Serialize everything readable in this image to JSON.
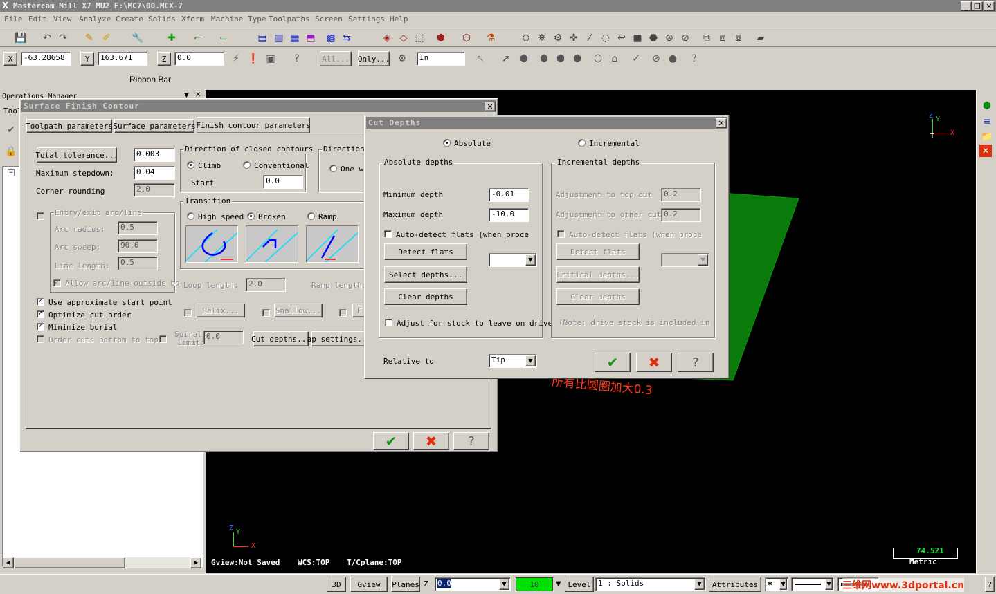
{
  "app": {
    "title": "Mastercam Mill X7 MU2  F:\\MC7\\00.MCX-7",
    "menu": [
      "File",
      "Edit",
      "View",
      "Analyze",
      "Create",
      "Solids",
      "Xform",
      "Machine Type",
      "Toolpaths",
      "Screen",
      "Settings",
      "Help"
    ]
  },
  "coords": {
    "x_label": "X",
    "x_value": "-63.28658",
    "y_label": "Y",
    "y_value": "163.671",
    "z_label": "Z",
    "z_value": "0.0",
    "all_label": "All...",
    "only_label": "Only...",
    "units": "In"
  },
  "ribbon_bar_label": "Ribbon Bar",
  "ops_manager": {
    "title": "Operations Manager",
    "tab_label": "Tool"
  },
  "surface_dialog": {
    "title": "Surface Finish Contour",
    "tabs": [
      "Toolpath parameters",
      "Surface parameters",
      "Finish contour parameters"
    ],
    "total_tolerance_btn": "Total tolerance...",
    "total_tolerance": "0.003",
    "max_stepdown_label": "Maximum stepdown:",
    "max_stepdown": "0.04",
    "corner_rounding_label": "Corner rounding",
    "corner_rounding": "2.0",
    "entry_exit_label": "Entry/exit arc/line",
    "arc_radius_label": "Arc radius:",
    "arc_radius": "0.5",
    "arc_sweep_label": "Arc sweep:",
    "arc_sweep": "90.0",
    "line_length_label": "Line length:",
    "line_length": "0.5",
    "allow_outside_label": "Allow arc/line outside bo",
    "use_approx_label": "Use approximate start point",
    "optimize_label": "Optimize cut order",
    "minimize_label": "Minimize burial",
    "order_cuts_label": "Order cuts bottom to top",
    "direction_closed_title": "Direction of closed contours",
    "climb_label": "Climb",
    "conventional_label": "Conventional",
    "start_label": "Start",
    "start_value": "0.0",
    "direction_open_title": "Direction",
    "one_way_label": "One wa",
    "transition_title": "Transition",
    "high_speed_label": "High speed",
    "broken_label": "Broken",
    "ramp_label": "Ramp",
    "loop_length_label": "Loop length:",
    "loop_length": "2.0",
    "ramp_length_label": "Ramp length:",
    "helix_btn": "Helix...",
    "shallow_btn": "Shallow...",
    "f_btn": "F",
    "spiral_label_1": "Spiral",
    "spiral_label_2": "limit:",
    "spiral_value": "0.0",
    "cut_depths_btn": "Cut depths...",
    "gap_settings_btn": "ap settings..."
  },
  "cut_depths_dialog": {
    "title": "Cut Depths",
    "absolute_label": "Absolute",
    "incremental_label": "Incremental",
    "abs_group_title": "Absolute depths",
    "min_depth_label": "Minimum depth",
    "min_depth": "-0.01",
    "max_depth_label": "Maximum depth",
    "max_depth": "-10.0",
    "auto_detect_label": "Auto-detect flats (when proce",
    "detect_flats_btn": "Detect flats",
    "select_depths_btn": "Select depths...",
    "clear_depths_btn": "Clear depths",
    "adjust_stock_label": "Adjust for stock to leave on drive",
    "inc_group_title": "Incremental depths",
    "adj_top_label": "Adjustment to top cut",
    "adj_top": "0.2",
    "adj_other_label": "Adjustment to other cuts",
    "adj_other": "0.2",
    "inc_auto_detect_label": "Auto-detect flats (when proce",
    "inc_detect_btn": "Detect flats",
    "critical_btn": "Critical depths...",
    "inc_clear_btn": "Clear depths",
    "note_label": "(Note: drive stock is included in",
    "relative_to_label": "Relative to",
    "relative_to_value": "Tip"
  },
  "viewport": {
    "annotation": "所有比圆圈加大0.3",
    "status_gview": "Gview:Not Saved",
    "status_wcs": "WCS:TOP",
    "status_tcplane": "T/Cplane:TOP",
    "scale_value": "74.521",
    "scale_unit": "Metric",
    "axis_x": "X",
    "axis_y": "Y",
    "axis_z": "Z",
    "axis_t": "T"
  },
  "statusbar": {
    "btn_3d": "3D",
    "btn_gview": "Gview",
    "btn_planes": "Planes",
    "z_label": "Z",
    "z_value": "0.0",
    "color_value": "10",
    "level_label": "Level",
    "level_value": "1 : Solids",
    "attributes_label": "Attributes",
    "watermark": "三维网www.3dportal.cn"
  },
  "colors": {
    "viewport_bg": "#000000",
    "surface_green": "#0a7a0a",
    "annotation_red": "#ff3b1f",
    "color_swatch": "#00e000",
    "scale_green": "#22e03a"
  }
}
